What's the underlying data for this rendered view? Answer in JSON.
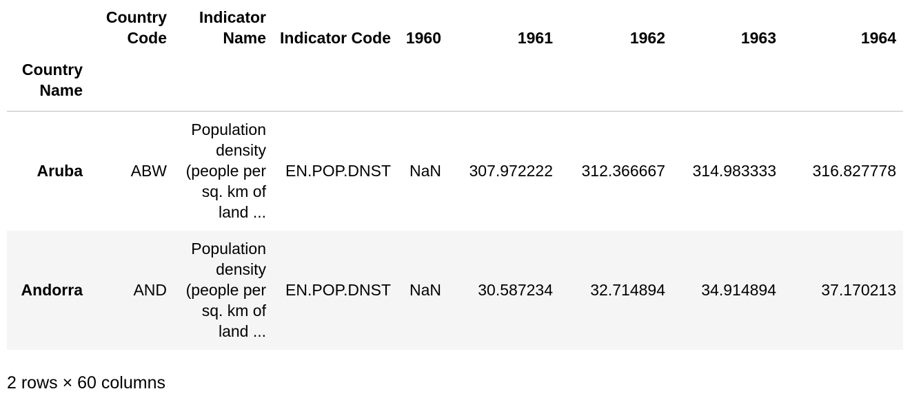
{
  "table": {
    "columns": [
      "Country Code",
      "Indicator Name",
      "Indicator Code",
      "1960",
      "1961",
      "1962",
      "1963",
      "1964"
    ],
    "index_label": "Country Name",
    "rows": [
      {
        "index": "Aruba",
        "cells": [
          "ABW",
          "Population density (people per sq. km of land ...",
          "EN.POP.DNST",
          "NaN",
          "307.972222",
          "312.366667",
          "314.983333",
          "316.827778"
        ]
      },
      {
        "index": "Andorra",
        "cells": [
          "AND",
          "Population density (people per sq. km of land ...",
          "EN.POP.DNST",
          "NaN",
          "30.587234",
          "32.714894",
          "34.914894",
          "37.170213"
        ]
      }
    ]
  },
  "footer": "2 rows × 60 columns"
}
